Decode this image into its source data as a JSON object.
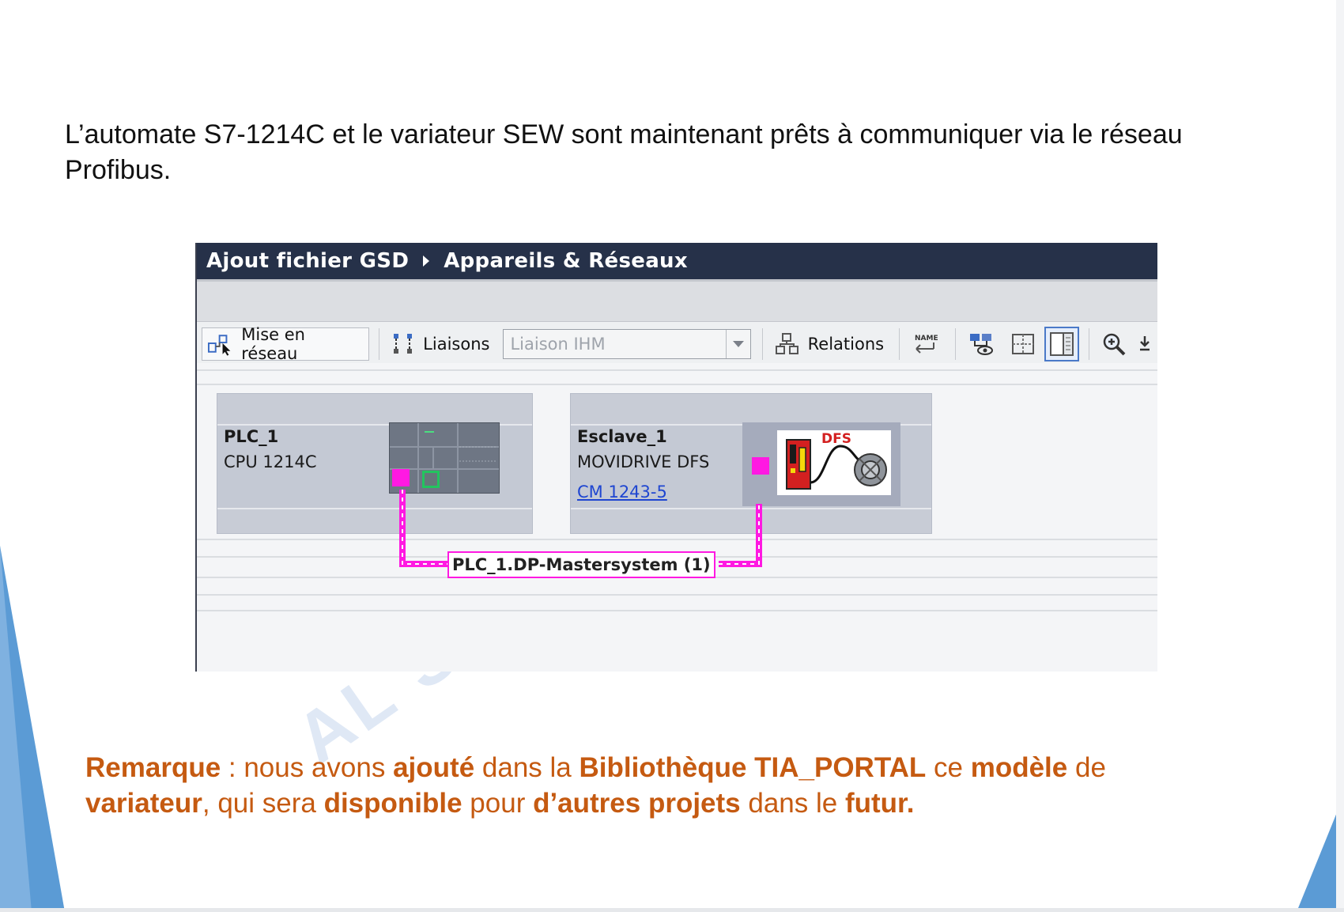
{
  "slide": {
    "intro_text": "L’automate S7-1214C et le variateur SEW sont maintenant prêts à communiquer via le réseau Profibus.",
    "watermark": "AL          ST",
    "remark": {
      "p1": "Remarque",
      "p2": " : nous avons ",
      "p3": "ajouté",
      "p4": " dans la ",
      "p5": "Bibliothèque TIA_PORTAL",
      "p6": " ce ",
      "p7": "modèle",
      "p8": " de ",
      "p9": "variateur",
      "p10": ", qui sera ",
      "p11": "disponible",
      "p12": " pour ",
      "p13": "d’autres projets",
      "p14": " dans le ",
      "p15": "futur."
    },
    "colors": {
      "remark": "#c55a11",
      "accent_blue": "#5b9bd5",
      "network": "#ff19e2",
      "titlebar": "#263149"
    }
  },
  "window": {
    "breadcrumb": [
      "Ajout fichier GSD",
      "Appareils & Réseaux"
    ],
    "toolbar": {
      "network_button": "Mise en réseau",
      "connections_button": "Liaisons",
      "connection_type": "Liaison IHM",
      "relations_button": "Relations",
      "icons": [
        "network-icon",
        "connections-icon",
        "relations-icon",
        "name-icon",
        "network-view-icon",
        "grid-icon",
        "panel-icon",
        "zoom-icon",
        "download-icon"
      ]
    },
    "devices": [
      {
        "name": "PLC_1",
        "type": "CPU 1214C"
      },
      {
        "name": "Esclave_1",
        "type": "MOVIDRIVE DFS",
        "link": "CM 1243-5",
        "image_label": "DFS"
      }
    ],
    "network": {
      "label": "PLC_1.DP-Mastersystem (1)"
    }
  }
}
